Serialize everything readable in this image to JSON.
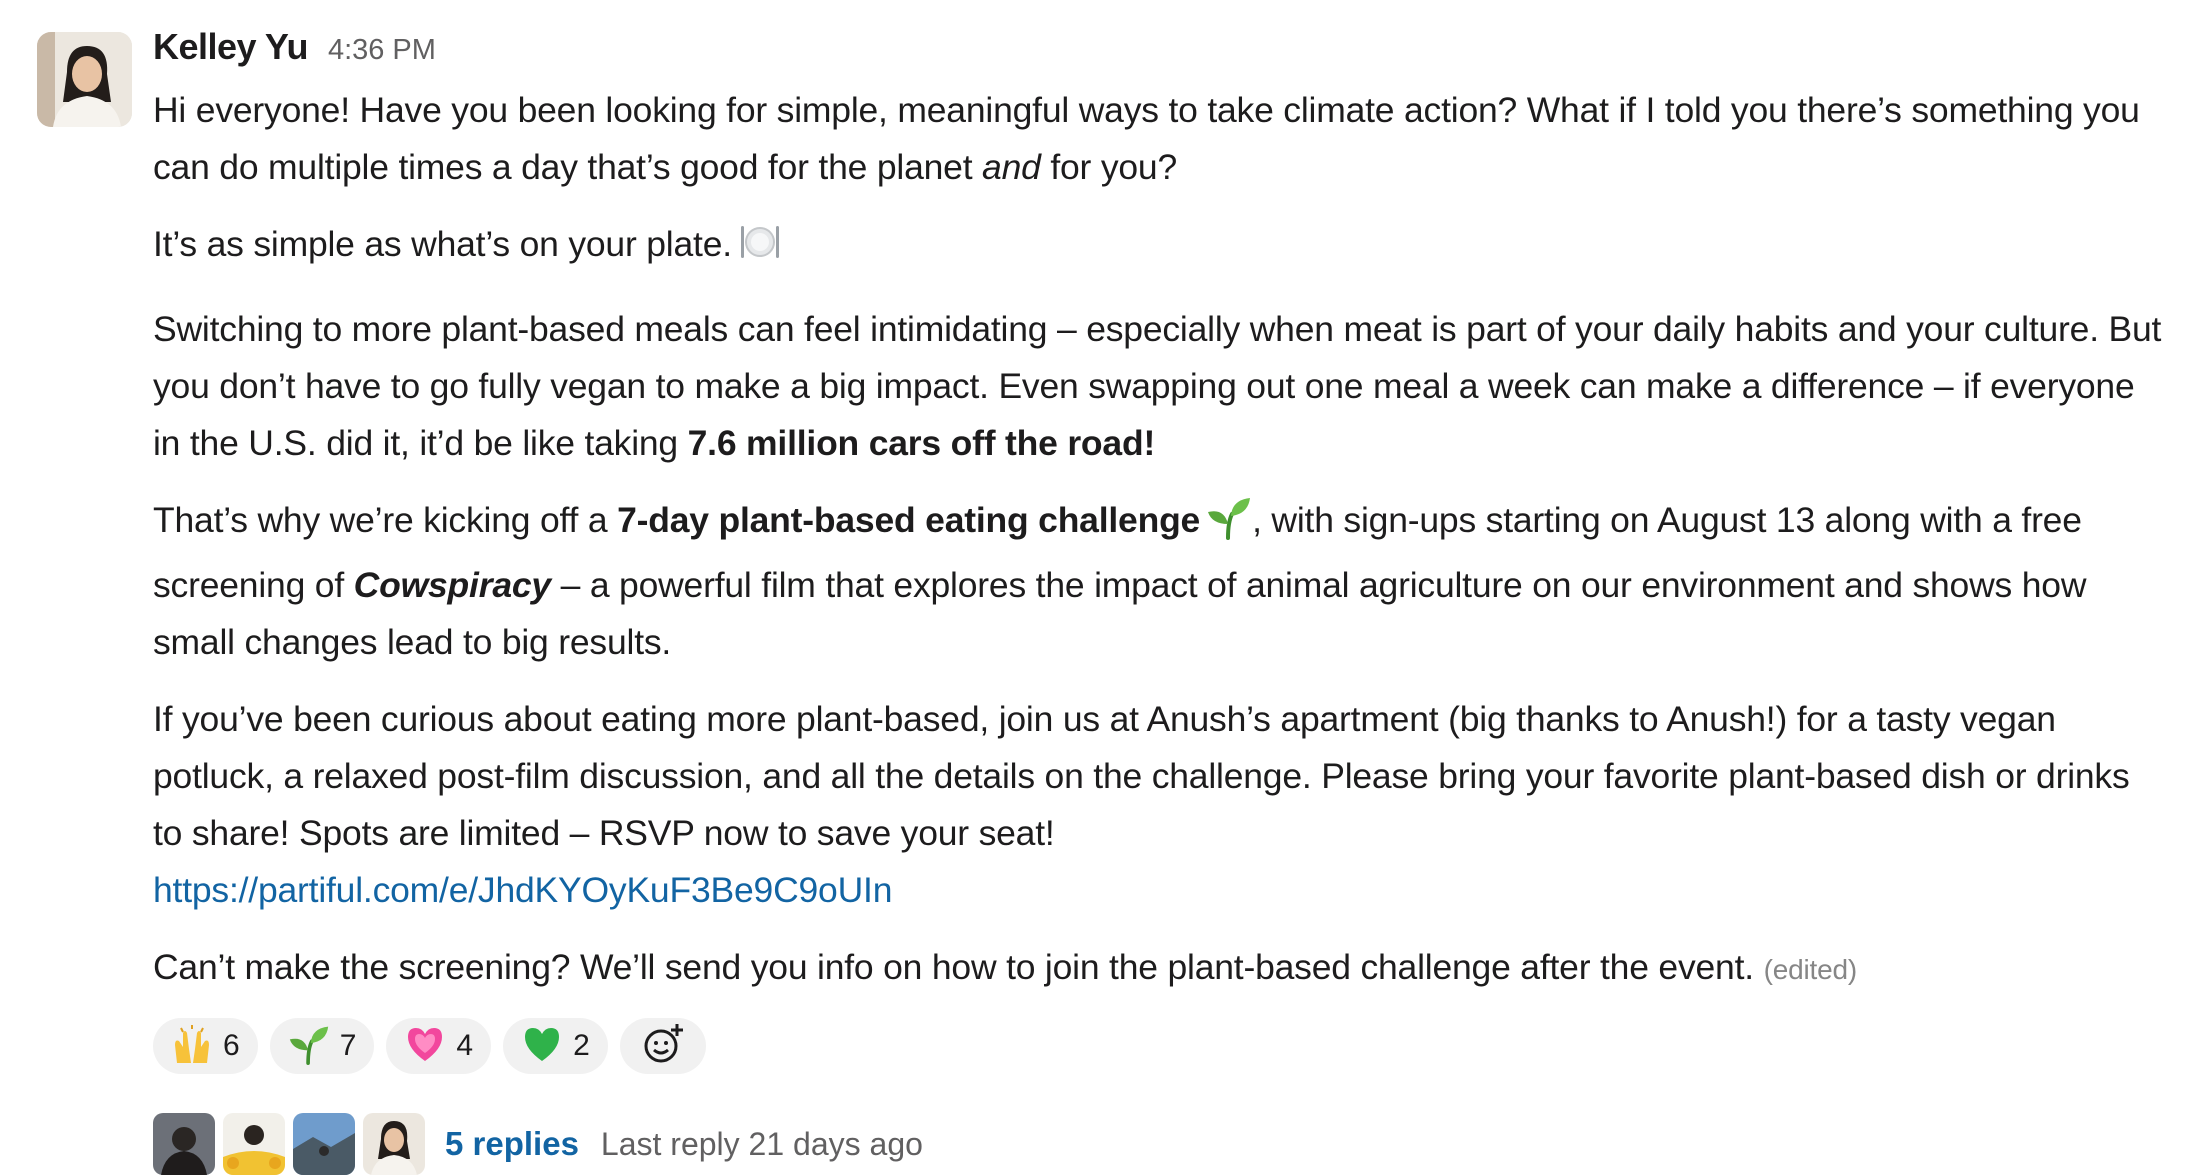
{
  "message": {
    "sender": "Kelley Yu",
    "timestamp": "4:36 PM",
    "p1": {
      "a": "Hi everyone! Have you been looking for simple, meaningful ways to take climate action? What if I told you there’s something you can do multiple times a day that’s good for the planet ",
      "b_italic": "and",
      "c": " for you?"
    },
    "p2": {
      "text": "It’s as simple as what’s on your plate.",
      "emoji": "plate-fork-knife-icon"
    },
    "p3": {
      "a": "Switching to more plant-based meals can feel intimidating – especially when meat is part of your daily habits and your culture. But you don’t have to go fully vegan to make a big impact. Even swapping out one meal a week can make a difference – if everyone in the U.S. did it, it’d be like taking ",
      "b_bold": "7.6 million cars off the road!"
    },
    "p4": {
      "a": "That’s why we’re kicking off a ",
      "b_bold": "7-day plant-based eating challenge",
      "emoji": "seedling-icon",
      "c": ", with sign-ups starting on August 13 along with a free screening of ",
      "d_bold_italic": "Cowspiracy",
      "e": " – a powerful film that explores the impact of animal agriculture on our environment and shows how small changes lead to big results."
    },
    "p5": {
      "text": "If you’ve been curious about eating more plant-based, join us at Anush’s apartment (big thanks to Anush!) for a tasty vegan potluck, a relaxed post-film discussion, and all the details on the challenge. Please bring your favorite plant-based dish or drinks to share! Spots are limited – RSVP now to save your seat!",
      "link": "https://partiful.com/e/JhdKYOyKuF3Be9C9oUIn"
    },
    "p6": {
      "text": "Can’t make the screening? We’ll send you info on how to join the plant-based challenge after the event.",
      "edited": "(edited)"
    }
  },
  "reactions": [
    {
      "icon": "raising-hands-icon",
      "count": "6"
    },
    {
      "icon": "seedling-icon",
      "count": "7"
    },
    {
      "icon": "growing-heart-icon",
      "count": "4"
    },
    {
      "icon": "green-heart-icon",
      "count": "2"
    }
  ],
  "add_reaction_icon": "add-reaction-icon",
  "thread": {
    "replies": "5 replies",
    "last_reply": "Last reply 21 days ago"
  },
  "colors": {
    "link": "#1264a3",
    "reaction_bg": "#f1f1f1",
    "muted_text": "#616061"
  }
}
